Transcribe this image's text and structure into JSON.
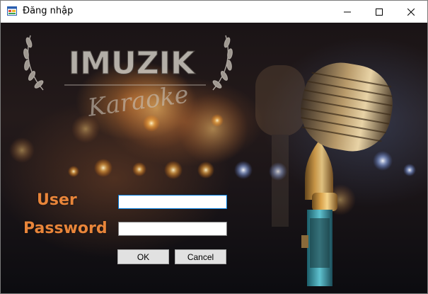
{
  "window": {
    "title": "Đăng nhập",
    "icon": "winforms-app-icon",
    "controls": {
      "minimize": "minimize-icon",
      "maximize": "maximize-icon",
      "close": "close-icon"
    }
  },
  "banner": {
    "logo_text": "IMUZIK",
    "logo_subtext": "Karaoke"
  },
  "form": {
    "user_label": "User",
    "password_label": "Password",
    "user_value": "",
    "password_value": "",
    "ok_label": "OK",
    "cancel_label": "Cancel"
  },
  "colors": {
    "label_accent": "#e8853a",
    "focus_border": "#0078d7"
  }
}
